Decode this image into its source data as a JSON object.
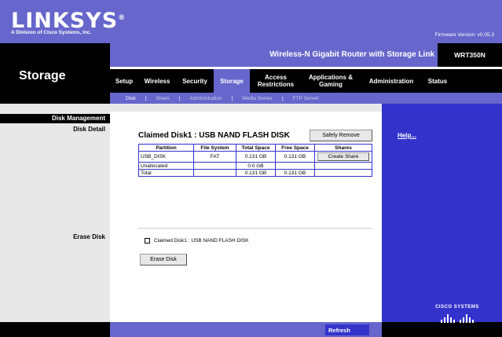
{
  "brand": {
    "logo": "LINKSYS",
    "registered": "®",
    "subtitle": "A Division of Cisco Systems, Inc.",
    "firmware": "Firmware Version: v0.05.3"
  },
  "product": {
    "name": "Wireless-N Gigabit Router with Storage Link",
    "model": "WRT350N"
  },
  "section_title": "Storage",
  "tabs": [
    {
      "label": "Setup"
    },
    {
      "label": "Wireless"
    },
    {
      "label": "Security"
    },
    {
      "label": "Storage"
    },
    {
      "label": "Access Restrictions"
    },
    {
      "label": "Applications & Gaming"
    },
    {
      "label": "Administration"
    },
    {
      "label": "Status"
    }
  ],
  "subtabs": [
    {
      "label": "Disk"
    },
    {
      "label": "Share"
    },
    {
      "label": "Administration"
    },
    {
      "label": "Media Server"
    },
    {
      "label": "FTP Server"
    }
  ],
  "left": {
    "heading": "Disk Management",
    "disk_detail": "Disk Detail",
    "erase_disk": "Erase Disk"
  },
  "disk": {
    "title": "Claimed Disk1 : USB NAND FLASH DISK",
    "safely_remove": "Safely Remove",
    "columns": [
      "Partition",
      "File System",
      "Total Space",
      "Free Space",
      "Shares"
    ],
    "rows": [
      {
        "partition": "USB_DISK",
        "fs": "FAT",
        "total": "0.131 GB",
        "free": "0.131 GB",
        "shares": "Create Share"
      },
      {
        "partition": "Unallocated",
        "fs": "",
        "total": "0.0 GB",
        "free": "",
        "shares": ""
      },
      {
        "partition": "Total",
        "fs": "",
        "total": "0.131 GB",
        "free": "0.131 GB",
        "shares": ""
      }
    ]
  },
  "erase": {
    "checkbox_label": "Claimed Disk1 : USB NAND FLASH DISK",
    "button": "Erase Disk"
  },
  "help": "Help...",
  "refresh": "Refresh",
  "cisco": "CISCO SYSTEMS",
  "colors": {
    "brand_purple": "#6666cc",
    "brand_blue": "#3333cc",
    "black": "#000000"
  }
}
